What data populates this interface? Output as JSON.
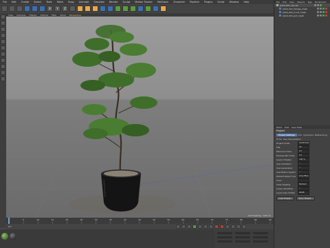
{
  "menu": [
    "File",
    "Edit",
    "Create",
    "Select",
    "Tools",
    "Mesh",
    "Snap",
    "Animate",
    "Simulate",
    "Render",
    "Sculpt",
    "Motion Tracker",
    "MoGraph",
    "Character",
    "Pipeline",
    "Plugins",
    "Script",
    "Window",
    "Help"
  ],
  "toolbar_icons": [
    "undo-icon",
    "redo-icon",
    "live-select-icon",
    "move-icon",
    "scale-icon",
    "rotate-icon",
    "x-axis-icon",
    "y-axis-icon",
    "z-axis-icon",
    "coordinate-system-icon",
    "render-view-icon",
    "render-picture-icon",
    "render-settings-icon",
    "cube-icon",
    "pen-icon",
    "subdivision-icon",
    "array-icon",
    "instance-icon",
    "deformer-icon",
    "environment-icon",
    "camera-icon",
    "light-icon"
  ],
  "toolbar_letters": [
    "X",
    "Y",
    "Z"
  ],
  "viewport": {
    "menu": [
      "View",
      "Cameras",
      "Display",
      "Options",
      "Filter",
      "Panel"
    ],
    "label": "Perspective",
    "status": "Grid Spacing : 100 cm"
  },
  "timeline": {
    "ticks": [
      "0",
      "5",
      "10",
      "15",
      "20",
      "25",
      "30",
      "35",
      "40",
      "45",
      "50",
      "55",
      "60",
      "65",
      "70",
      "75",
      "80",
      "85",
      "90"
    ],
    "frame": "0 F"
  },
  "object_manager": {
    "menu": [
      "File",
      "Edit",
      "View",
      "Objects",
      "Tags",
      "Bookmarks"
    ],
    "objects": [
      "plant_001_obj.obj",
      "plant_001_foliage_mesh",
      "plant_001_trunk_mesh",
      "plant_001_pot_mesh"
    ]
  },
  "attribute_manager": {
    "menu": [
      "Mode",
      "Edit",
      "User Data"
    ],
    "title": "Project",
    "tabs": [
      "Project Settings",
      "Info",
      "Dynamics",
      "Referencing",
      "To Do",
      "Key Interpolation"
    ],
    "rows": [
      {
        "label": "Project Scale",
        "value": "Centimeters"
      },
      {
        "label": "FPS",
        "value": "30"
      },
      {
        "label": "Minimum Time",
        "value": "0 F"
      },
      {
        "label": "Preview Min Time",
        "value": "0 F"
      },
      {
        "label": "Level of Detail",
        "value": "100 %"
      },
      {
        "label": "Use Animation",
        "value": "✓"
      },
      {
        "label": "Use Generators",
        "value": "✓"
      },
      {
        "label": "Use Motion System",
        "value": "✓"
      },
      {
        "label": "Default Object Color",
        "value": "Gray Blue"
      },
      {
        "label": "Color",
        "value": ""
      },
      {
        "label": "View Clipping",
        "value": "Medium"
      },
      {
        "label": "Linear Workflow",
        "value": "✓"
      },
      {
        "label": "Input Color Profile",
        "value": "sRGB"
      }
    ],
    "buttons": [
      "Load Preset...",
      "Save Preset..."
    ]
  },
  "colors": {
    "accent": "#e9a64b",
    "selection": "#5b7fb4",
    "foliage": "#3f6e2a",
    "pot": "#141414"
  }
}
